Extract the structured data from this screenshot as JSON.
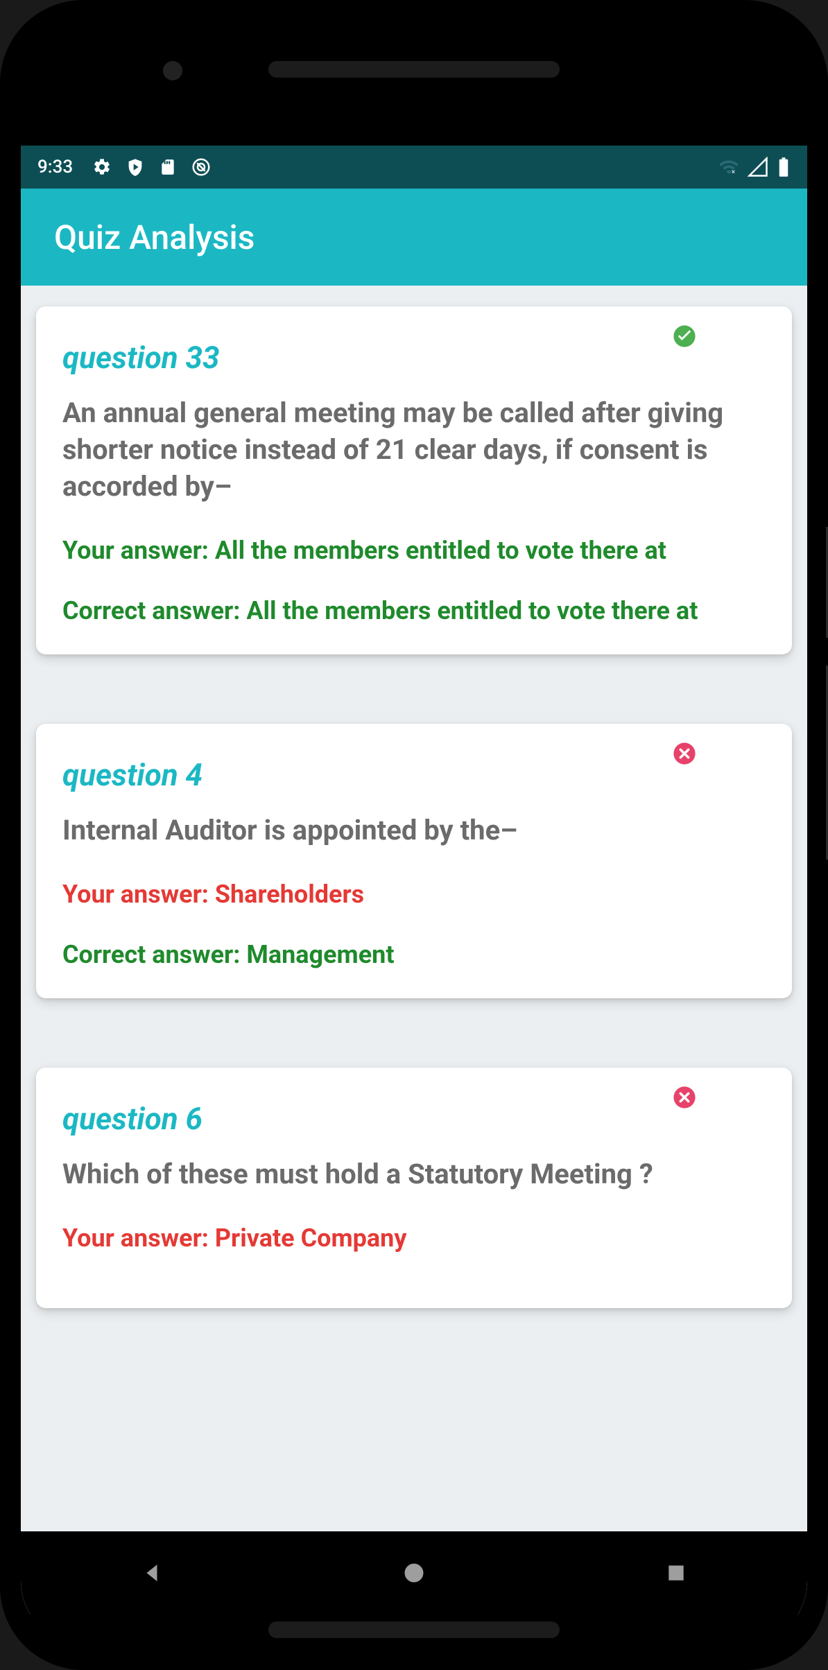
{
  "status": {
    "time": "9:33"
  },
  "app": {
    "title": "Quiz Analysis"
  },
  "questions": [
    {
      "label": "question 33",
      "correct": true,
      "text": "An annual general meeting may be called after giving shorter notice instead of 21 clear days, if consent is accorded by–",
      "your_answer": "Your answer: All the members entitled to vote there at",
      "correct_answer": "Correct answer: All the members entitled to vote there at"
    },
    {
      "label": "question 4",
      "correct": false,
      "text": "Internal Auditor is appointed by the–",
      "your_answer": "Your answer: Shareholders",
      "correct_answer": "Correct answer: Management"
    },
    {
      "label": "question 6",
      "correct": false,
      "text": "Which of these must hold a Statutory Meeting ?",
      "your_answer": "Your answer: Private Company",
      "correct_answer": ""
    }
  ]
}
